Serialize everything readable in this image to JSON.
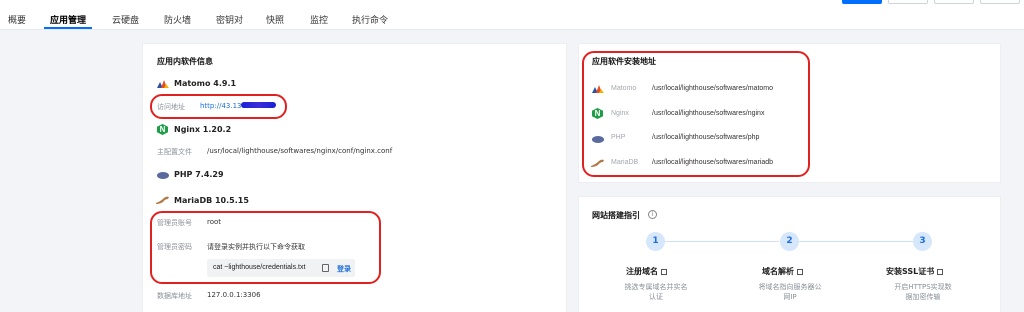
{
  "tabs": [
    {
      "label": "概要"
    },
    {
      "label": "应用管理"
    },
    {
      "label": "云硬盘"
    },
    {
      "label": "防火墙"
    },
    {
      "label": "密钥对"
    },
    {
      "label": "快照"
    },
    {
      "label": "监控"
    },
    {
      "label": "执行命令"
    }
  ],
  "left": {
    "title": "应用内软件信息",
    "matomo_name": "Matomo 4.9.1",
    "access_label": "访问地址",
    "access_value": "http://43.138",
    "nginx_name": "Nginx 1.20.2",
    "conf_label": "主配置文件",
    "conf_value": "/usr/local/lighthouse/softwares/nginx/conf/nginx.conf",
    "php_name": "PHP 7.4.29",
    "mariadb_name": "MariaDB 10.5.15",
    "admin_label": "管理员账号",
    "admin_value": "root",
    "pwd_label": "管理员密码",
    "pwd_value": "请登录实例并执行以下命令获取",
    "command": "cat ~lighthouse/credentials.txt",
    "login": "登录",
    "db_label": "数据库地址",
    "db_value": "127.0.0.1:3306"
  },
  "install": {
    "title": "应用软件安装地址",
    "rows": [
      {
        "name": "Matomo",
        "path": "/usr/local/lighthouse/softwares/matomo"
      },
      {
        "name": "Nginx",
        "path": "/usr/local/lighthouse/softwares/nginx"
      },
      {
        "name": "PHP",
        "path": "/usr/local/lighthouse/softwares/php"
      },
      {
        "name": "MariaDB",
        "path": "/usr/local/lighthouse/softwares/mariadb"
      }
    ]
  },
  "guide": {
    "title": "网站搭建指引",
    "steps": [
      {
        "num": "1",
        "title": "注册域名",
        "desc1": "挑选专属域名并实名",
        "desc2": "认证"
      },
      {
        "num": "2",
        "title": "域名解析",
        "desc1": "将域名指向服务器公",
        "desc2": "网IP"
      },
      {
        "num": "3",
        "title": "安装SSL证书",
        "desc1": "开启HTTPS实现数",
        "desc2": "据加密传输"
      }
    ]
  },
  "colors": {
    "accent": "#006eff",
    "highlight": "#e0211f"
  },
  "icons": [
    "matomo-icon",
    "nginx-icon",
    "php-icon",
    "mariadb-icon",
    "copy-icon",
    "external-link-icon",
    "info-icon"
  ]
}
